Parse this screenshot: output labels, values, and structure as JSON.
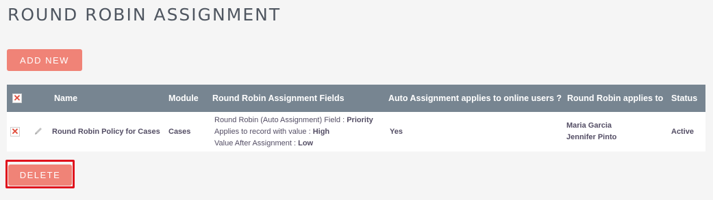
{
  "page": {
    "title": "ROUND ROBIN ASSIGNMENT"
  },
  "toolbar": {
    "add_new_label": "ADD NEW",
    "delete_label": "DELETE"
  },
  "table": {
    "headers": {
      "name": "Name",
      "module": "Module",
      "fields": "Round Robin Assignment Fields",
      "auto_assignment": "Auto Assignment applies to online users ?",
      "applies_to": "Round Robin applies to",
      "status": "Status"
    },
    "rows": [
      {
        "name": "Round Robin Policy for Cases",
        "module": "Cases",
        "field_label": "Round Robin (Auto Assignment) Field : ",
        "field_value": "Priority",
        "applies_value_label": "Applies to record with value : ",
        "applies_value": "High",
        "after_label": "Value After Assignment : ",
        "after_value": "Low",
        "auto_assignment": "Yes",
        "users": [
          "Maria Garcia",
          "Jennifer Pinto"
        ],
        "status": "Active"
      }
    ]
  },
  "icons": {
    "select_all": "checkbox-x-icon",
    "row_select": "checkbox-x-icon",
    "edit": "pencil-icon"
  },
  "colors": {
    "accent_button": "#f08377",
    "header_bg": "#778591",
    "highlight_border": "#e0101c",
    "checkbox_x": "#e04b3a"
  }
}
